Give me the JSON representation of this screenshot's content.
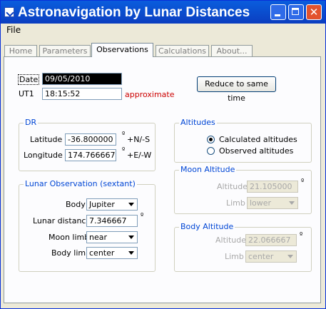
{
  "window": {
    "title": "Astronavigation by Lunar Distances"
  },
  "menu": {
    "file": "File"
  },
  "tabs": [
    "Home",
    "Parameters",
    "Observations",
    "Calculations",
    "About..."
  ],
  "date": {
    "label": "Date",
    "value": "09/05/2010"
  },
  "ut1": {
    "label": "UT1",
    "value": "18:15:52",
    "note": "approximate"
  },
  "reduce_button": "Reduce to same time",
  "dr": {
    "title": "DR",
    "latitude_label": "Latitude",
    "latitude_value": "-36.800000",
    "latitude_unit": "+N/-S",
    "longitude_label": "Longitude",
    "longitude_value": "174.766667",
    "longitude_unit": "+E/-W",
    "degree_symbol": "º"
  },
  "lunar": {
    "title": "Lunar Observation (sextant)",
    "body_label": "Body",
    "body_value": "Jupiter",
    "distance_label": "Lunar distance",
    "distance_value": "7.346667",
    "moon_limb_label": "Moon limb",
    "moon_limb_value": "near",
    "body_limb_label": "Body limb",
    "body_limb_value": "center"
  },
  "altitudes": {
    "title": "Altitudes",
    "calculated": "Calculated altitudes",
    "observed": "Observed altitudes",
    "selected": "calculated"
  },
  "moon_altitude": {
    "title": "Moon Altitude",
    "altitude_label": "Altitude",
    "altitude_value": "21.105000",
    "limb_label": "Limb",
    "limb_value": "lower"
  },
  "body_altitude": {
    "title": "Body Altitude",
    "altitude_label": "Altitude",
    "altitude_value": "22.066667",
    "limb_label": "Limb",
    "limb_value": "center"
  },
  "colors": {
    "titlebar": "#0b3ec0",
    "group_title": "#0046d5",
    "note": "#cc0000"
  }
}
